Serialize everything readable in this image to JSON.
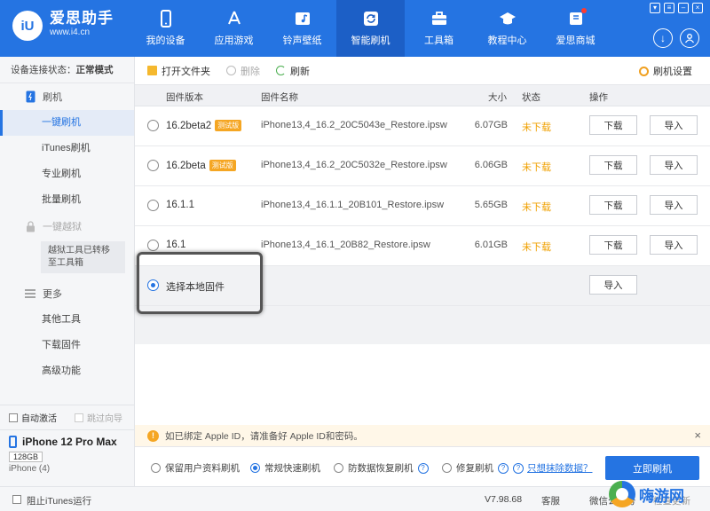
{
  "header": {
    "logo_mark": "iU",
    "logo_title": "爱思助手",
    "logo_url": "www.i4.cn",
    "nav": [
      {
        "label": "我的设备",
        "icon": "phone-icon"
      },
      {
        "label": "应用游戏",
        "icon": "app-store-icon"
      },
      {
        "label": "铃声壁纸",
        "icon": "music-icon"
      },
      {
        "label": "智能刷机",
        "icon": "refresh-icon",
        "active": true
      },
      {
        "label": "工具箱",
        "icon": "toolbox-icon"
      },
      {
        "label": "教程中心",
        "icon": "graduation-cap-icon"
      },
      {
        "label": "爱思商城",
        "icon": "shop-icon"
      }
    ]
  },
  "sidebar": {
    "conn_label": "设备连接状态：",
    "conn_value": "正常模式",
    "group_flash": "刷机",
    "items_flash": [
      "一键刷机",
      "iTunes刷机",
      "专业刷机",
      "批量刷机"
    ],
    "group_jailbreak": "一键越狱",
    "jailbreak_note": "越狱工具已转移至工具箱",
    "group_more": "更多",
    "items_more": [
      "其他工具",
      "下载固件",
      "高级功能"
    ],
    "auto_activate": "自动激活",
    "skip_guide": "跳过向导",
    "device_name": "iPhone 12 Pro Max",
    "device_capacity": "128GB",
    "device_model": "iPhone (4)"
  },
  "toolbar": {
    "open_folder": "打开文件夹",
    "delete": "删除",
    "refresh": "刷新",
    "settings": "刷机设置"
  },
  "table": {
    "headers": {
      "version": "固件版本",
      "name": "固件名称",
      "size": "大小",
      "status": "状态",
      "action": "操作"
    },
    "rows": [
      {
        "version": "16.2beta2",
        "tag": "测试版",
        "name": "iPhone13,4_16.2_20C5043e_Restore.ipsw",
        "size": "6.07GB",
        "status": "未下载"
      },
      {
        "version": "16.2beta",
        "tag": "测试版",
        "name": "iPhone13,4_16.2_20C5032e_Restore.ipsw",
        "size": "6.06GB",
        "status": "未下载"
      },
      {
        "version": "16.1.1",
        "tag": "",
        "name": "iPhone13,4_16.1.1_20B101_Restore.ipsw",
        "size": "5.65GB",
        "status": "未下载"
      },
      {
        "version": "16.1",
        "tag": "",
        "name": "iPhone13,4_16.1_20B82_Restore.ipsw",
        "size": "6.01GB",
        "status": "未下载"
      }
    ],
    "download_label": "下载",
    "import_label": "导入",
    "local_label": "选择本地固件"
  },
  "notice": {
    "text": "如已绑定 Apple ID，请准备好 Apple ID和密码。"
  },
  "modes": {
    "keep_data": "保留用户资料刷机",
    "quick": "常规快速刷机",
    "anti_recovery": "防数据恢复刷机",
    "repair": "修复刷机",
    "erase_link": "只想抹除数据？",
    "flash_now": "立即刷机"
  },
  "footer": {
    "block_itunes": "阻止iTunes运行",
    "version": "V7.98.68",
    "service": "客服",
    "wechat": "微信公众号",
    "update": "检查更新"
  },
  "watermark": {
    "text": "嗨游网"
  }
}
